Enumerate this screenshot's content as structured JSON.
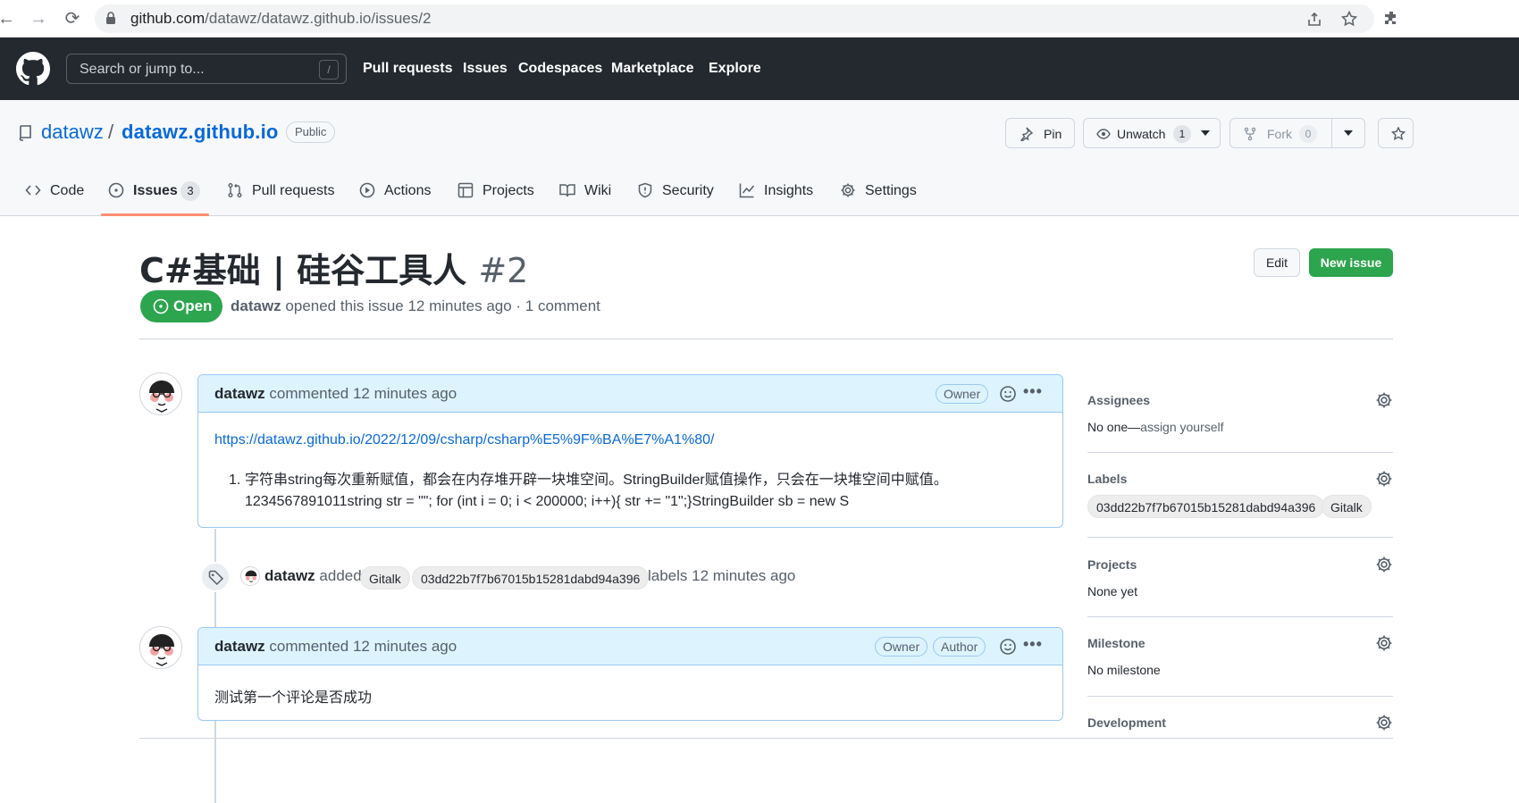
{
  "browser": {
    "url_host": "github.com",
    "url_path": "/datawz/datawz.github.io/issues/2"
  },
  "header": {
    "search_placeholder": "Search or jump to...",
    "search_shortcut": "/",
    "nav": [
      "Pull requests",
      "Issues",
      "Codespaces",
      "Marketplace",
      "Explore"
    ]
  },
  "repo": {
    "owner": "datawz",
    "separator": "/",
    "name": "datawz.github.io",
    "visibility": "Public",
    "pin_label": "Pin",
    "unwatch_label": "Unwatch",
    "watch_count": "1",
    "fork_label": "Fork",
    "fork_count": "0"
  },
  "tabs": [
    {
      "label": "Code",
      "icon": "code-icon"
    },
    {
      "label": "Issues",
      "icon": "issue-opened-icon",
      "count": "3",
      "active": true
    },
    {
      "label": "Pull requests",
      "icon": "git-pull-request-icon"
    },
    {
      "label": "Actions",
      "icon": "play-icon"
    },
    {
      "label": "Projects",
      "icon": "table-icon"
    },
    {
      "label": "Wiki",
      "icon": "book-icon"
    },
    {
      "label": "Security",
      "icon": "shield-icon"
    },
    {
      "label": "Insights",
      "icon": "graph-icon"
    },
    {
      "label": "Settings",
      "icon": "gear-icon"
    }
  ],
  "issue": {
    "title": "C#基础 | 硅谷工具人",
    "number": "#2",
    "state": "Open",
    "author": "datawz",
    "meta": " opened this issue 12 minutes ago · 1 comment",
    "edit_label": "Edit",
    "new_issue_label": "New issue"
  },
  "comments": [
    {
      "author": "datawz",
      "action": " commented 12 minutes ago",
      "badges": [
        "Owner"
      ],
      "link": "https://datawz.github.io/2022/12/09/csharp/csharp%E5%9F%BA%E7%A1%80/",
      "list_marker": "1.",
      "list_line1": "字符串string每次重新赋值，都会在内存堆开辟一块堆空间。StringBuilder赋值操作，只会在一块堆空间中赋值。",
      "list_line2": "1234567891011string str = \"\"; for (int i = 0; i < 200000; i++){ str += \"1\";}StringBuilder sb = new S"
    },
    {
      "author": "datawz",
      "action": " commented 12 minutes ago",
      "badges": [
        "Owner",
        "Author"
      ],
      "body": "测试第一个评论是否成功"
    }
  ],
  "event": {
    "actor": "datawz",
    "action": " added",
    "labels": [
      "Gitalk",
      "03dd22b7f7b67015b15281dabd94a396"
    ],
    "suffix": "labels 12 minutes ago"
  },
  "sidebar": {
    "assignees_title": "Assignees",
    "assignees_value": "No one—",
    "assignees_link": "assign yourself",
    "labels_title": "Labels",
    "labels": [
      "03dd22b7f7b67015b15281dabd94a396",
      "Gitalk"
    ],
    "projects_title": "Projects",
    "projects_value": "None yet",
    "milestone_title": "Milestone",
    "milestone_value": "No milestone",
    "development_title": "Development"
  },
  "colors": {
    "header_bg": "#24292f",
    "open_green": "#2da44e",
    "link_blue": "#0969da",
    "tab_underline": "#fd8c73",
    "comment_header": "#ddf4ff"
  }
}
